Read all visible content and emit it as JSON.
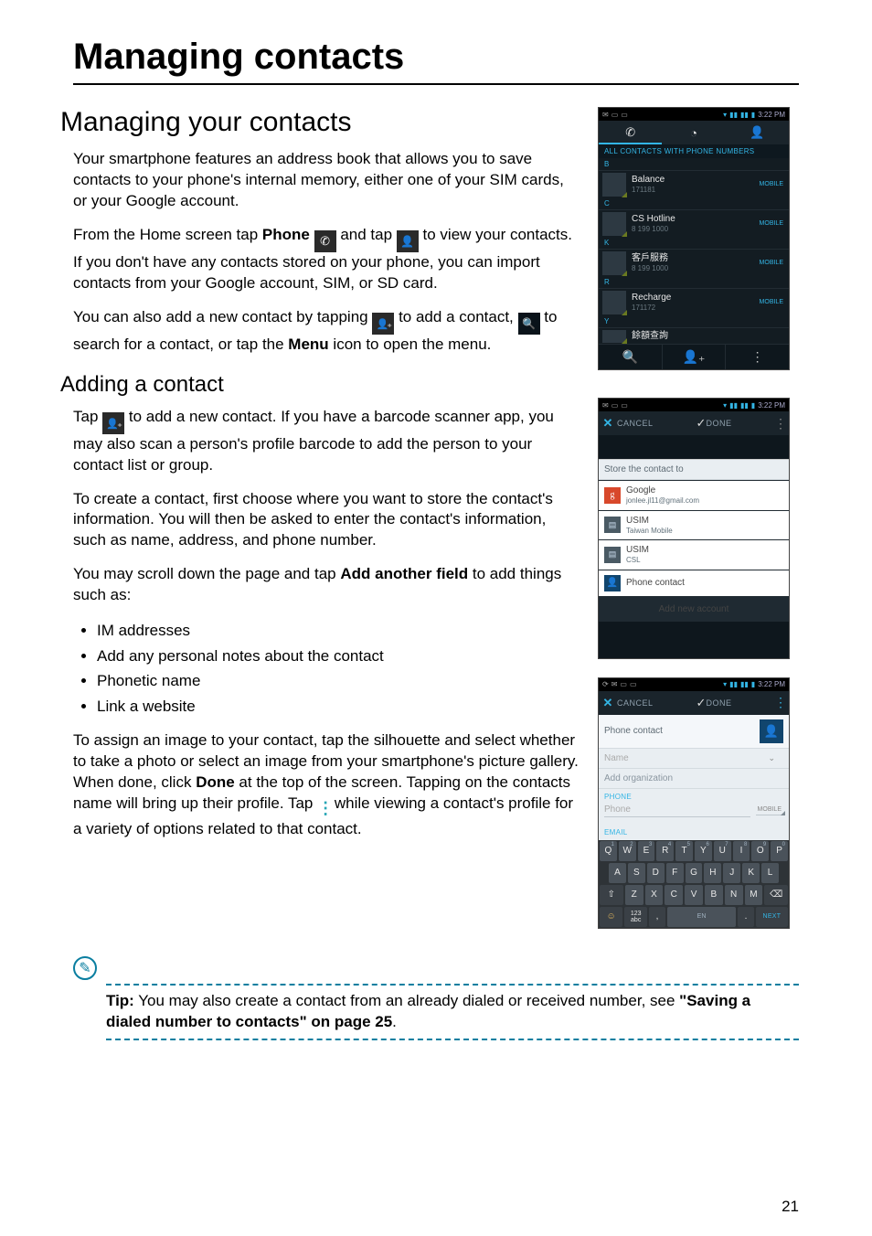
{
  "page_number": "21",
  "chapter_title": "Managing contacts",
  "h2_1": "Managing your contacts",
  "p1": "Your smartphone features an address book that allows you to save contacts to your phone's internal memory, either one of your SIM cards, or your Google account.",
  "p2_a": "From the Home screen tap ",
  "p2_b_phone": "Phone",
  "p2_c": " and tap ",
  "p2_d": " to view your contacts. If you don't have any contacts stored on your phone, you can import contacts from your Google account, SIM, or SD card.",
  "p3_a": "You can also add a new contact by tapping ",
  "p3_b": " to add a contact, ",
  "p3_c": " to search for a contact, or tap the ",
  "p3_menu": "Menu",
  "p3_d": " icon to open the menu.",
  "h3_1": "Adding a contact",
  "p4_a": "Tap ",
  "p4_b": " to add a new contact. If you have a barcode scanner app, you may also scan a person's profile barcode to add the person to your contact list or group.",
  "p5": "To create a contact, first choose where you want to store the contact's information. You will then be asked to enter the contact's information, such as name, address, and phone number.",
  "p6_a": "You may scroll down the page and tap ",
  "p6_b": "Add another field",
  "p6_c": " to add things such as:",
  "bullets": [
    "IM addresses",
    "Add any personal notes about the contact",
    "Phonetic name",
    "Link a website"
  ],
  "p7_a": "To assign an image to your contact, tap the silhouette and select whether to take a photo or select an image from your smartphone's picture gallery. When done, click ",
  "p7_done": "Done",
  "p7_b": " at the top of the screen. Tapping on the contacts name will bring up their profile. Tap ",
  "p7_c": " while viewing a contact's profile for a variety of options related to that contact.",
  "tip_label": "Tip:",
  "tip_text": " You may also create a contact from an already dialed or received number, see ",
  "tip_link": "\"Saving a dialed number to contacts\" on page 25",
  "tip_tail": ".",
  "shot1": {
    "time_label": "3:22 PM",
    "header": "ALL CONTACTS WITH PHONE NUMBERS",
    "rows": [
      {
        "letter": "B",
        "name": "Balance",
        "sub": "171181",
        "type": "MOBILE"
      },
      {
        "letter": "C",
        "name": "CS Hotline",
        "sub": "8 199 1000",
        "type": "MOBILE"
      },
      {
        "letter": "K",
        "name": "客戶服務",
        "sub": "8 199 1000",
        "type": "MOBILE"
      },
      {
        "letter": "R",
        "name": "Recharge",
        "sub": "171172",
        "type": "MOBILE"
      },
      {
        "letter": "Y",
        "name": "餘額查詢",
        "sub": "",
        "type": ""
      }
    ]
  },
  "shot2": {
    "cancel": "CANCEL",
    "done": "DONE",
    "store_to": "Store the contact to",
    "options": [
      {
        "k": "g",
        "name": "Google",
        "sub": "jonlee.jl11@gmail.com"
      },
      {
        "k": "s",
        "name": "USIM",
        "sub": "Taiwan Mobile"
      },
      {
        "k": "s",
        "name": "USIM",
        "sub": "CSL"
      },
      {
        "k": "p",
        "name": "Phone contact",
        "sub": ""
      }
    ],
    "add_account": "Add new account"
  },
  "shot3": {
    "cancel": "CANCEL",
    "done": "DONE",
    "phone_contact": "Phone contact",
    "name_field": "Name",
    "add_org": "Add organization",
    "lbl_phone": "PHONE",
    "ph_phone": "Phone",
    "mobile": "MOBILE",
    "lbl_email": "EMAIL",
    "keys_r1": [
      "Q",
      "W",
      "E",
      "R",
      "T",
      "Y",
      "U",
      "I",
      "O",
      "P"
    ],
    "keys_r2": [
      "A",
      "S",
      "D",
      "F",
      "G",
      "H",
      "J",
      "K",
      "L"
    ],
    "keys_r3": [
      "Z",
      "X",
      "C",
      "V",
      "B",
      "N",
      "M"
    ],
    "key_123": "123",
    "key_abc": "abc",
    "key_en": "EN",
    "key_next": "NEXT"
  }
}
